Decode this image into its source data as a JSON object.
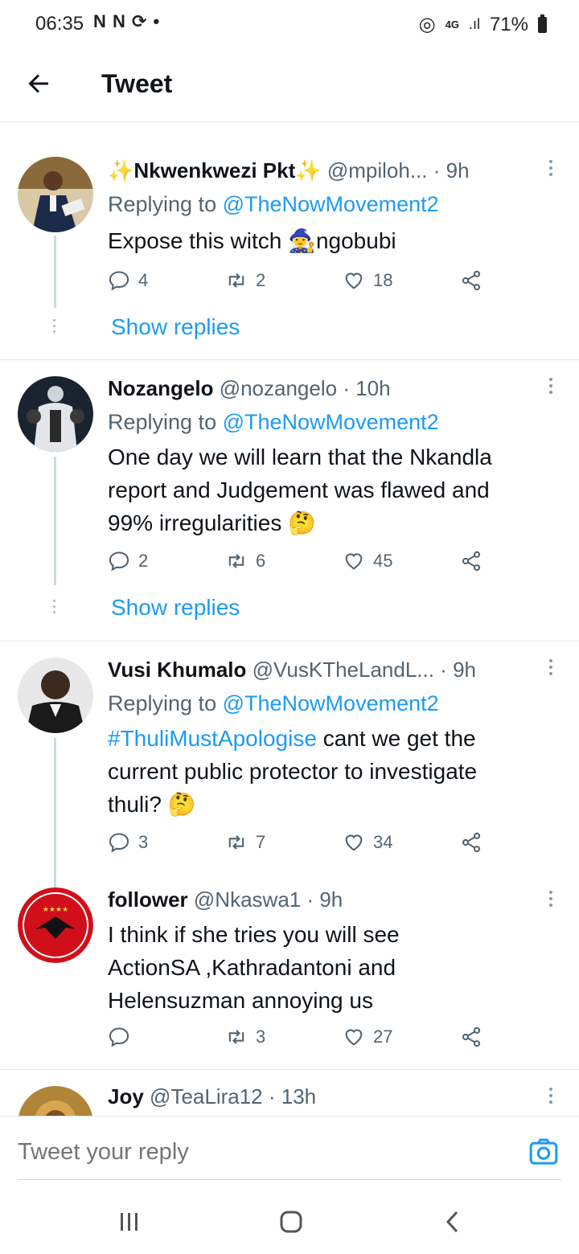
{
  "status_bar": {
    "time": "06:35",
    "icons": "N N",
    "network": "4G",
    "battery": "71%"
  },
  "header": {
    "title": "Tweet"
  },
  "tweets": [
    {
      "name": "✨Nkwenkwezi Pkt✨",
      "handle": "@mpiloh...",
      "time": "· 9h",
      "replying_prefix": "Replying to",
      "replying_to": "@TheNowMovement2",
      "text": "Expose this witch 🧙‍♀️ngobubi",
      "replies": "4",
      "retweets": "2",
      "likes": "18",
      "show_replies": "Show replies"
    },
    {
      "name": "Nozangelo",
      "handle": "@nozangelo",
      "time": "· 10h",
      "replying_prefix": "Replying to",
      "replying_to": "@TheNowMovement2",
      "text_lines": [
        "One day we will learn that the Nkandla",
        "report and Judgement was flawed and",
        "99% irregularities 🤔"
      ],
      "replies": "2",
      "retweets": "6",
      "likes": "45",
      "show_replies": "Show replies"
    },
    {
      "name": "Vusi Khumalo",
      "handle": "@VusKTheLandL...",
      "time": "· 9h",
      "replying_prefix": "Replying to",
      "replying_to": "@TheNowMovement2",
      "hashtag": "#ThuliMustApologise",
      "text_rest": " cant we get the",
      "text_lines": [
        "current public protector to investigate",
        "thuli? 🤔"
      ],
      "replies": "3",
      "retweets": "7",
      "likes": "34"
    },
    {
      "name": "follower",
      "handle": "@Nkaswa1",
      "time": "· 9h",
      "text_lines": [
        "I think if she tries you will see",
        "ActionSA ,Kathradantoni and",
        "Helensuzman annoying us"
      ],
      "replies": "",
      "retweets": "3",
      "likes": "27"
    },
    {
      "name": "Joy",
      "handle": "@TeaLira12",
      "time": "· 13h"
    }
  ],
  "reply_bar": {
    "placeholder": "Tweet your reply"
  },
  "icons": [
    "back-arrow-icon",
    "more-icon",
    "reply-icon",
    "retweet-icon",
    "like-icon",
    "share-icon",
    "camera-icon",
    "recent-apps-icon",
    "home-icon",
    "back-icon"
  ],
  "colors": {
    "link": "#1d9bf0",
    "secondary_text": "#536471",
    "thread_line": "#cfd9de"
  }
}
